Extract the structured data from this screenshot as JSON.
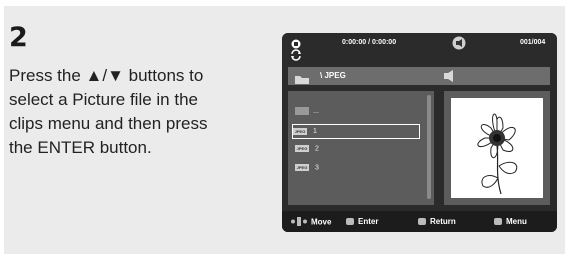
{
  "step": {
    "number": "2"
  },
  "instruction": {
    "lines": [
      "Press the ▲/▼ buttons to",
      "select a Picture file in the",
      "clips menu and then press",
      "the ENTER button."
    ]
  },
  "screen": {
    "time": "0:00:00 / 0:00:00",
    "track_count": "001/004",
    "path": "\\ JPEG",
    "list": {
      "parent": "...",
      "items": [
        {
          "tag": "JPEG",
          "label": "1"
        },
        {
          "tag": "JPEG",
          "label": "2"
        },
        {
          "tag": "JPEG",
          "label": "3"
        }
      ],
      "selected_index": 0
    },
    "footer": {
      "move": "Move",
      "enter": "Enter",
      "return": "Return",
      "menu": "Menu"
    },
    "icons": {
      "stop": "stop-icon",
      "repeat": "repeat-icon",
      "speaker": "speaker-icon",
      "folder": "folder-icon",
      "volume": "volume-icon"
    }
  }
}
